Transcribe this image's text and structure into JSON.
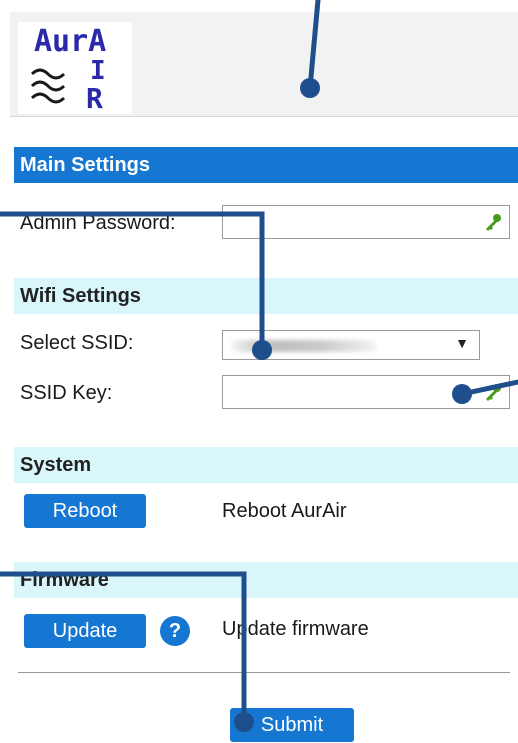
{
  "logo": {
    "line1": "AurA",
    "line2": "I",
    "line3": "R"
  },
  "main_settings": {
    "heading": "Main Settings",
    "admin_password_label": "Admin Password:"
  },
  "wifi_settings": {
    "heading": "Wifi Settings",
    "select_ssid_label": "Select SSID:",
    "ssid_key_label": "SSID Key:"
  },
  "system": {
    "heading": "System",
    "reboot_button": "Reboot",
    "reboot_description": "Reboot AurAir"
  },
  "firmware": {
    "heading": "Firmware",
    "update_button": "Update",
    "help_glyph": "?",
    "update_description": "Update firmware"
  },
  "submit_button": "Submit",
  "icons": {
    "password_field": "key-icon",
    "ssid_key_field": "key-icon",
    "help": "help-icon"
  },
  "colors": {
    "accent": "#1677d2",
    "section_light": "#d9f7fb",
    "callout": "#1f4e8c",
    "key": "#4a9a1a"
  }
}
